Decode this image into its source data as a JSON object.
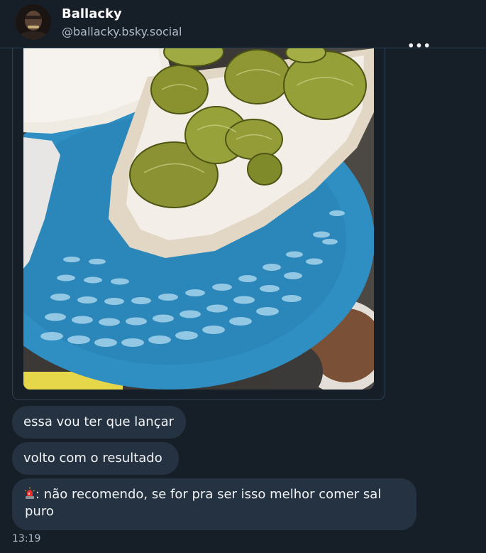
{
  "profile": {
    "display_name": "Ballacky",
    "handle": "@ballacky.bsky.social",
    "avatar_icon": "avatar-photo"
  },
  "post": {
    "more_icon": "more-options-icon",
    "more_label": "•••",
    "image_alt_icon": "photo-pickles-sandwich"
  },
  "messages": [
    {
      "text": "essa vou ter que lançar"
    },
    {
      "text": "volto com o resultado"
    },
    {
      "emoji_icon": "police-siren-icon",
      "text": ": não recomendo, se for pra ser isso melhor comer sal puro"
    }
  ],
  "timestamp": "13:19",
  "colors": {
    "background": "#161e27",
    "bubble": "#243241",
    "border": "#2e4052",
    "muted_text": "#aebbc9",
    "plate_blue": "#2f8fc2",
    "pickle_green": "#7d8a2a"
  }
}
